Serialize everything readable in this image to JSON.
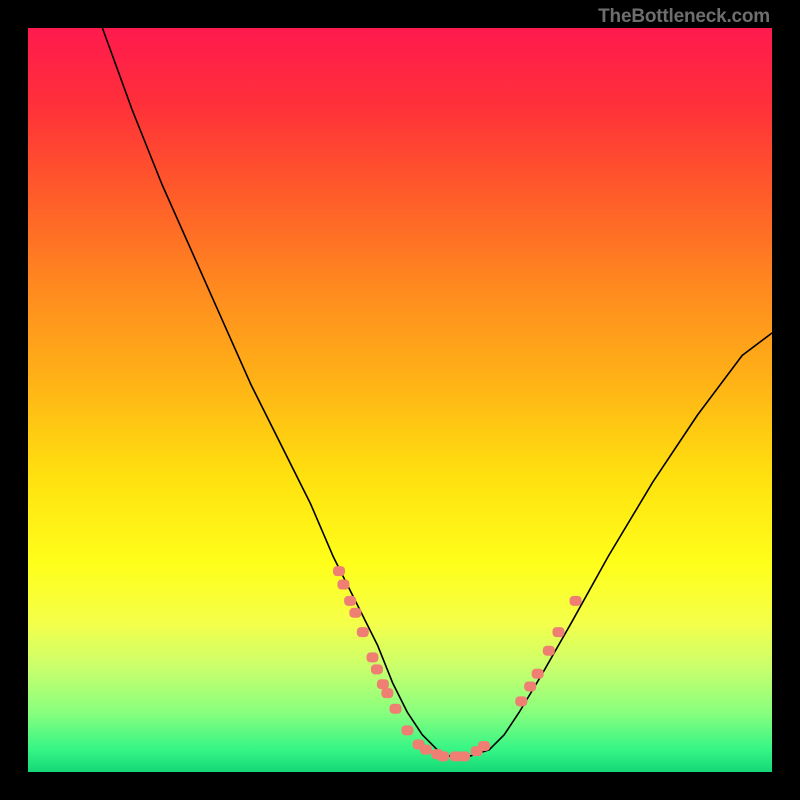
{
  "watermark": {
    "text": "TheBottleneck.com"
  },
  "chart_data": {
    "type": "line",
    "title": "",
    "xlabel": "",
    "ylabel": "",
    "xlim": [
      0,
      100
    ],
    "ylim": [
      0,
      100
    ],
    "series": [
      {
        "name": "bottleneck-curve",
        "color": "#000000",
        "x": [
          10,
          14,
          18,
          22,
          26,
          30,
          34,
          38,
          41,
          44,
          47,
          49,
          51,
          53,
          55,
          57,
          59,
          62,
          64,
          66,
          69,
          73,
          78,
          84,
          90,
          96,
          100
        ],
        "y": [
          100,
          89,
          79,
          70,
          61,
          52,
          44,
          36,
          29,
          23,
          17,
          12,
          8,
          5,
          3,
          2,
          2,
          3,
          5,
          8,
          13,
          20,
          29,
          39,
          48,
          56,
          59
        ]
      },
      {
        "name": "highlight-dots-left",
        "color": "#ee7f72",
        "marker": "square",
        "x": [
          41.8,
          42.4,
          43.3,
          44.0,
          45.0,
          46.3,
          46.9,
          47.7,
          48.3,
          49.4
        ],
        "y": [
          27.0,
          25.2,
          23.0,
          21.4,
          18.8,
          15.4,
          13.8,
          11.8,
          10.6,
          8.5
        ]
      },
      {
        "name": "highlight-dots-bottom",
        "color": "#ee7f72",
        "marker": "square",
        "x": [
          51.0,
          52.5,
          53.5,
          55.0,
          55.8,
          57.5,
          58.6,
          60.3,
          61.3
        ],
        "y": [
          5.6,
          3.7,
          3.0,
          2.4,
          2.1,
          2.1,
          2.1,
          2.8,
          3.5
        ]
      },
      {
        "name": "highlight-dots-right",
        "color": "#ee7f72",
        "marker": "square",
        "x": [
          66.3,
          67.5,
          68.5,
          70.0,
          71.3,
          73.6
        ],
        "y": [
          9.5,
          11.5,
          13.2,
          16.3,
          18.8,
          23.0
        ]
      }
    ],
    "background_gradient": {
      "direction": "vertical",
      "stops": [
        {
          "offset": 0.0,
          "color": "#ff1a4e"
        },
        {
          "offset": 0.1,
          "color": "#ff2f3a"
        },
        {
          "offset": 0.22,
          "color": "#ff5a2a"
        },
        {
          "offset": 0.35,
          "color": "#ff8a1f"
        },
        {
          "offset": 0.48,
          "color": "#ffb416"
        },
        {
          "offset": 0.6,
          "color": "#ffe00f"
        },
        {
          "offset": 0.72,
          "color": "#ffff1a"
        },
        {
          "offset": 0.8,
          "color": "#f4ff4a"
        },
        {
          "offset": 0.86,
          "color": "#c9ff6c"
        },
        {
          "offset": 0.92,
          "color": "#88ff7e"
        },
        {
          "offset": 0.97,
          "color": "#35f585"
        },
        {
          "offset": 1.0,
          "color": "#14d877"
        }
      ]
    }
  }
}
